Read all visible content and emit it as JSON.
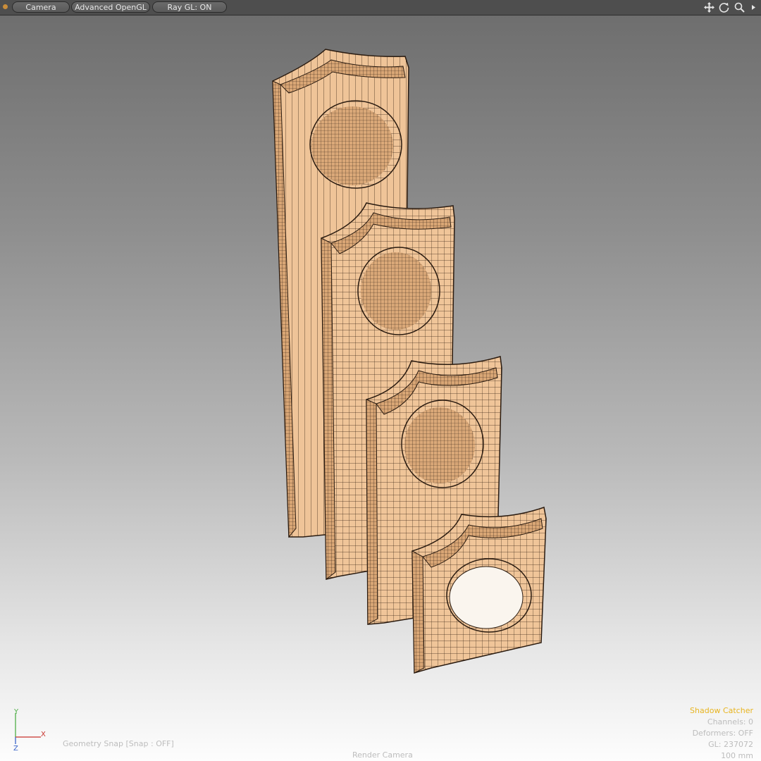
{
  "viewport_header": {
    "buttons": [
      {
        "label": "Camera"
      },
      {
        "label": "Advanced OpenGL"
      },
      {
        "label": "Ray GL: ON"
      }
    ],
    "nav_icons": [
      "move-view-icon",
      "rotate-view-icon",
      "zoom-view-icon",
      "viewport-menu-arrow-icon"
    ]
  },
  "hud": {
    "shadow_catcher": "Shadow Catcher",
    "channels": "Channels: 0",
    "deformers": "Deformers: OFF",
    "gl": "GL: 237072",
    "scale": "100 mm",
    "snap": "Geometry Snap  [Snap : OFF]",
    "camera": "Render Camera"
  },
  "axis": {
    "y": "Y",
    "x": "X",
    "z": "Z"
  },
  "colors": {
    "header_bg": "#4e4e4e",
    "accent_orange": "#e8b521",
    "mesh_fill": "#efc498",
    "mesh_wire": "#2a1b10",
    "axis_x": "#c8322c",
    "axis_y": "#4fae46",
    "axis_z": "#3a63c8"
  }
}
